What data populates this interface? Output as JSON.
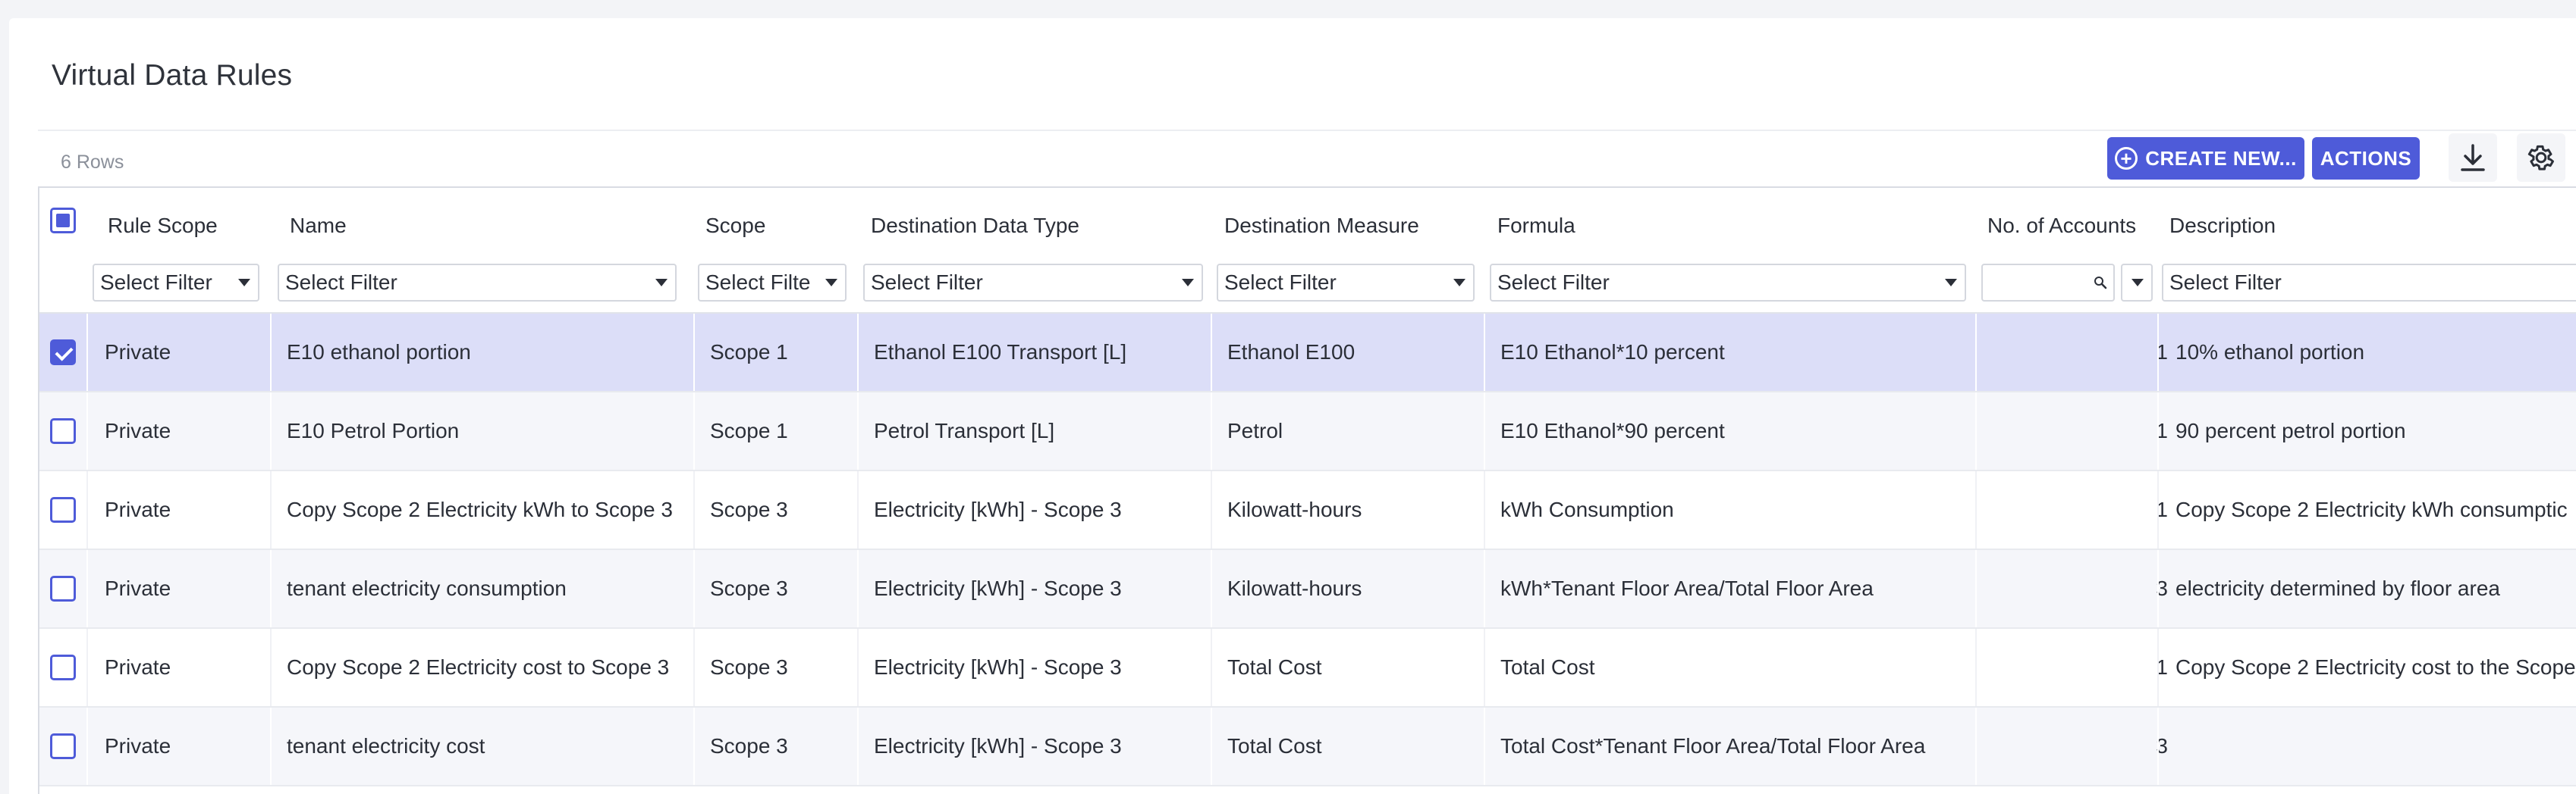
{
  "page": {
    "title": "Virtual Data Rules",
    "row_count": "6 Rows"
  },
  "toolbar": {
    "create_label": "CREATE NEW...",
    "actions_label": "ACTIONS",
    "download_icon": "download-icon",
    "settings_icon": "gear-icon"
  },
  "colors": {
    "accent": "#4e5bd9",
    "selected_row": "#dcdef8"
  },
  "columns": {
    "rule_scope": "Rule Scope",
    "name": "Name",
    "scope": "Scope",
    "dest_type": "Destination Data Type",
    "dest_measure": "Destination Measure",
    "formula": "Formula",
    "accounts": "No. of Accounts",
    "description": "Description"
  },
  "filters": {
    "rule_scope": "Select Filter",
    "name": "Select Filter",
    "scope": "Select Filte",
    "dest_type": "Select Filter",
    "dest_measure": "Select Filter",
    "formula": "Select Filter",
    "description": "Select Filter"
  },
  "rows": [
    {
      "selected": true,
      "rule_scope": "Private",
      "name": "E10 ethanol portion",
      "scope": "Scope 1",
      "dest_type": "Ethanol E100 Transport [L]",
      "dest_measure": "Ethanol E100",
      "formula": "E10 Ethanol*10 percent",
      "accounts": "1",
      "description": "10% ethanol portion"
    },
    {
      "selected": false,
      "rule_scope": "Private",
      "name": "E10 Petrol Portion",
      "scope": "Scope 1",
      "dest_type": "Petrol Transport [L]",
      "dest_measure": "Petrol",
      "formula": "E10 Ethanol*90 percent",
      "accounts": "1",
      "description": "90 percent petrol portion"
    },
    {
      "selected": false,
      "rule_scope": "Private",
      "name": "Copy Scope 2 Electricity kWh to Scope 3",
      "scope": "Scope 3",
      "dest_type": "Electricity [kWh] - Scope 3",
      "dest_measure": "Kilowatt-hours",
      "formula": "kWh Consumption",
      "accounts": "1",
      "description": "Copy Scope 2 Electricity kWh consumptic"
    },
    {
      "selected": false,
      "rule_scope": "Private",
      "name": "tenant electricity consumption",
      "scope": "Scope 3",
      "dest_type": "Electricity [kWh] - Scope 3",
      "dest_measure": "Kilowatt-hours",
      "formula": "kWh*Tenant Floor Area/Total Floor Area",
      "accounts": "3",
      "description": "electricity determined by floor area"
    },
    {
      "selected": false,
      "rule_scope": "Private",
      "name": "Copy Scope 2 Electricity cost to Scope 3",
      "scope": "Scope 3",
      "dest_type": "Electricity [kWh] - Scope 3",
      "dest_measure": "Total Cost",
      "formula": "Total Cost",
      "accounts": "1",
      "description": "Copy Scope 2 Electricity cost to the Scope"
    },
    {
      "selected": false,
      "rule_scope": "Private",
      "name": "tenant electricity cost",
      "scope": "Scope 3",
      "dest_type": "Electricity [kWh] - Scope 3",
      "dest_measure": "Total Cost",
      "formula": "Total Cost*Tenant Floor Area/Total Floor Area",
      "accounts": "3",
      "description": ""
    }
  ]
}
